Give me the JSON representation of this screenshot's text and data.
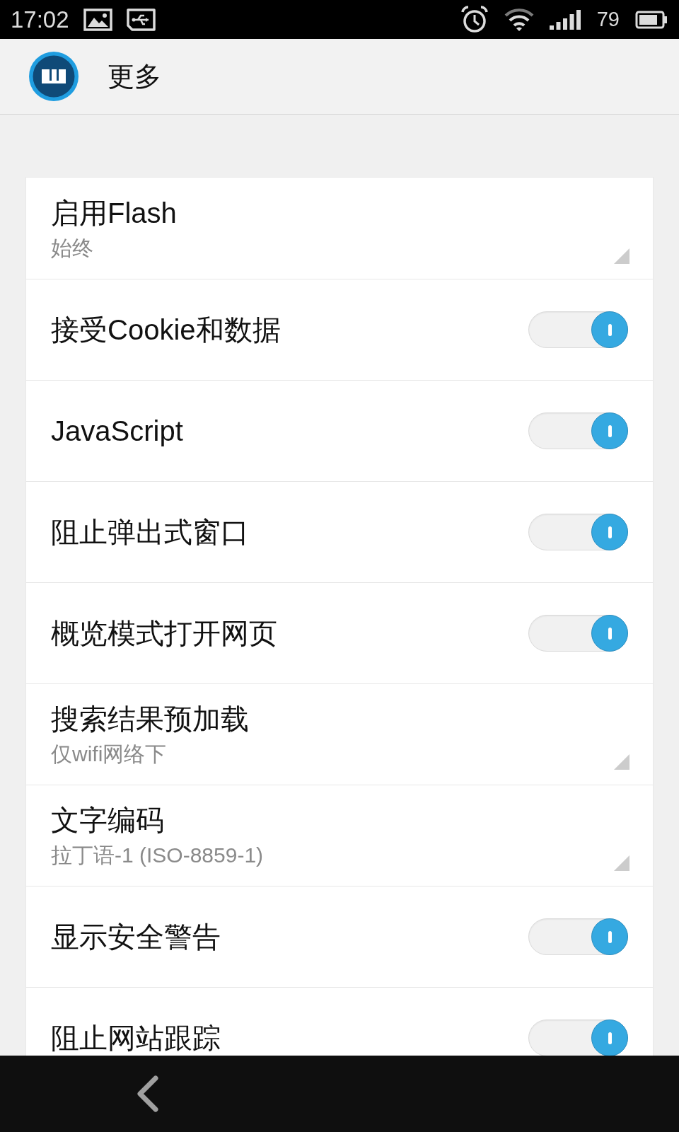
{
  "status_bar": {
    "time": "17:02",
    "battery": "79"
  },
  "header": {
    "title": "更多"
  },
  "settings": [
    {
      "kind": "dropdown",
      "title": "启用Flash",
      "value": "始终"
    },
    {
      "kind": "switch",
      "title": "接受Cookie和数据",
      "on": true
    },
    {
      "kind": "switch",
      "title": "JavaScript",
      "on": true
    },
    {
      "kind": "switch",
      "title": "阻止弹出式窗口",
      "on": true
    },
    {
      "kind": "switch",
      "title": "概览模式打开网页",
      "on": true
    },
    {
      "kind": "dropdown",
      "title": "搜索结果预加载",
      "value": "仅wifi网络下"
    },
    {
      "kind": "dropdown",
      "title": "文字编码",
      "value": "拉丁语-1 (ISO-8859-1)"
    },
    {
      "kind": "switch",
      "title": "显示安全警告",
      "on": true
    },
    {
      "kind": "switch",
      "title": "阻止网站跟踪",
      "on": true
    }
  ]
}
